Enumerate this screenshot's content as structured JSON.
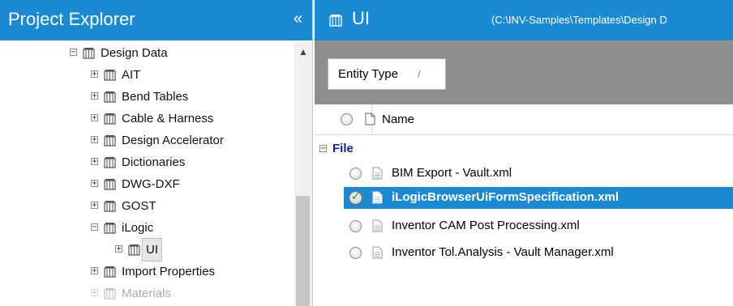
{
  "explorer": {
    "title": "Project Explorer",
    "collapse_glyph": "«",
    "items": [
      {
        "label": "Design Data",
        "expander": "−",
        "icon": "library-icon"
      },
      {
        "label": "AIT",
        "expander": "+",
        "icon": "library-icon"
      },
      {
        "label": "Bend Tables",
        "expander": "+",
        "icon": "library-icon"
      },
      {
        "label": "Cable & Harness",
        "expander": "+",
        "icon": "library-icon"
      },
      {
        "label": "Design Accelerator",
        "expander": "+",
        "icon": "library-icon"
      },
      {
        "label": "Dictionaries",
        "expander": "+",
        "icon": "library-icon"
      },
      {
        "label": "DWG-DXF",
        "expander": "+",
        "icon": "library-icon"
      },
      {
        "label": "GOST",
        "expander": "+",
        "icon": "library-icon"
      },
      {
        "label": "iLogic",
        "expander": "−",
        "icon": "library-icon"
      },
      {
        "label": "UI",
        "expander": "+",
        "icon": "library-icon"
      },
      {
        "label": "Import Properties",
        "expander": "+",
        "icon": "library-icon"
      },
      {
        "label": "Materials",
        "expander": "+",
        "icon": "library-icon"
      }
    ]
  },
  "panel": {
    "title": "UI",
    "path": "(C:\\INV-Samples\\Templates\\Design D",
    "group_by": {
      "label": "Entity Type",
      "sort_glyph": "/"
    },
    "column_name": "Name",
    "group": {
      "label": "File",
      "expander": "−"
    },
    "files": [
      {
        "name": "BIM Export - Vault.xml",
        "selected": false
      },
      {
        "name": "iLogicBrowserUiFormSpecification.xml",
        "selected": true
      },
      {
        "name": "Inventor CAM Post Processing.xml",
        "selected": false
      },
      {
        "name": "Inventor Tol.Analysis - Vault Manager.xml",
        "selected": false
      }
    ]
  },
  "colors": {
    "accent": "#1b8ad3",
    "groupbar": "#8e8e8e",
    "group_label": "#1b1b8c"
  }
}
